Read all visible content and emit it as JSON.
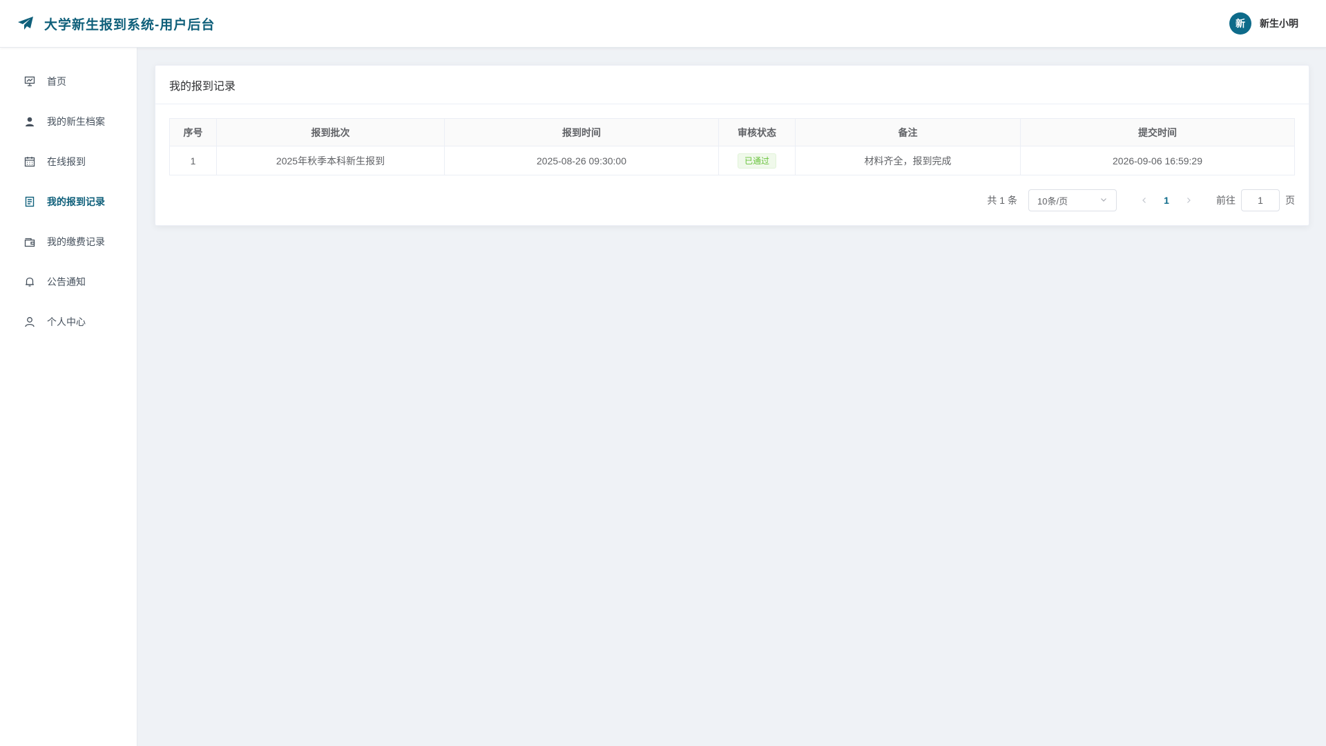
{
  "header": {
    "title": "大学新生报到系统-用户后台",
    "brand_icon": "paper-plane-icon",
    "avatar_text": "新",
    "username": "新生小明"
  },
  "sidebar": {
    "items": [
      {
        "label": "首页",
        "icon": "presentation-chart-icon",
        "active": false
      },
      {
        "label": "我的新生档案",
        "icon": "user-icon",
        "active": false
      },
      {
        "label": "在线报到",
        "icon": "calendar-icon",
        "active": false
      },
      {
        "label": "我的报到记录",
        "icon": "document-icon",
        "active": true
      },
      {
        "label": "我的缴费记录",
        "icon": "wallet-icon",
        "active": false
      },
      {
        "label": "公告通知",
        "icon": "bell-icon",
        "active": false
      },
      {
        "label": "个人中心",
        "icon": "user-outline-icon",
        "active": false
      }
    ]
  },
  "card": {
    "title": "我的报到记录"
  },
  "table": {
    "columns": [
      "序号",
      "报到批次",
      "报到时间",
      "审核状态",
      "备注",
      "提交时间"
    ],
    "rows": [
      {
        "index": "1",
        "batch": "2025年秋季本科新生报到",
        "checkin_time": "2025-08-26 09:30:00",
        "status": "已通过",
        "remark": "材料齐全，报到完成",
        "submit_time": "2026-09-06 16:59:29"
      }
    ]
  },
  "pagination": {
    "total": "共 1 条",
    "page_size": "10条/页",
    "current_page": "1",
    "goto_label": "前往",
    "goto_value": "1",
    "page_unit": "页"
  },
  "colors": {
    "brand": "#0e5f7a",
    "status_success": "#67c23a",
    "background": "#eff2f6"
  }
}
